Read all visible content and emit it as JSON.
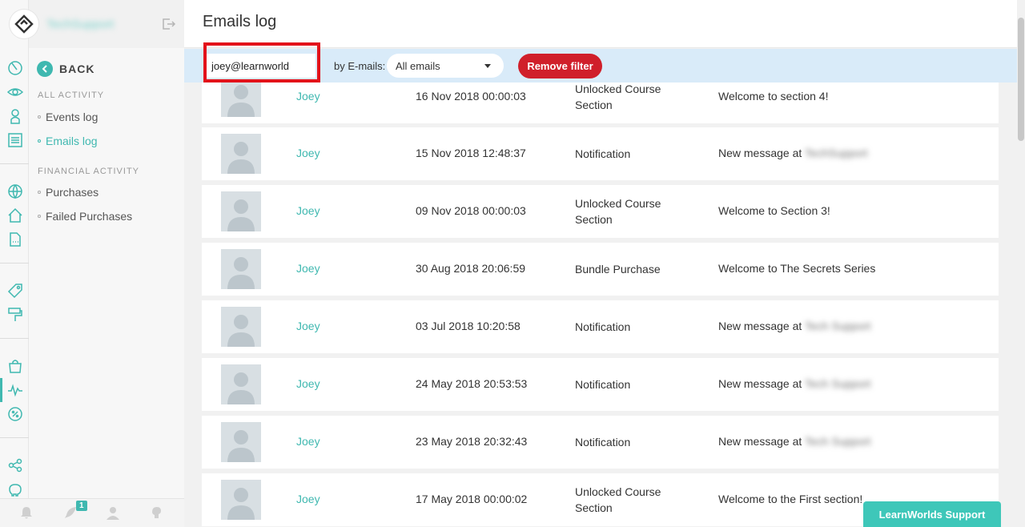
{
  "brand": {
    "name": "TechSupport"
  },
  "page": {
    "title": "Emails log"
  },
  "subnav": {
    "back_label": "BACK",
    "all_activity_heading": "ALL ACTIVITY",
    "financial_activity_heading": "FINANCIAL ACTIVITY",
    "items": [
      {
        "label": "Events log",
        "active": false
      },
      {
        "label": "Emails log",
        "active": true
      },
      {
        "label": "Purchases",
        "active": false
      },
      {
        "label": "Failed Purchases",
        "active": false
      }
    ]
  },
  "filter": {
    "search_value": "joey@learnworld",
    "by_label": "by E-mails:",
    "select_value": "All emails",
    "remove_label": "Remove filter"
  },
  "notification_count": "1",
  "rows": [
    {
      "name": "Joey",
      "date": "16 Nov 2018 00:00:03",
      "type": "Unlocked Course Section",
      "subject": "Welcome to section 4!",
      "subject_blur": ""
    },
    {
      "name": "Joey",
      "date": "15 Nov 2018 12:48:37",
      "type": "Notification",
      "subject": "New message at ",
      "subject_blur": "TechSupport"
    },
    {
      "name": "Joey",
      "date": "09 Nov 2018 00:00:03",
      "type": "Unlocked Course Section",
      "subject": "Welcome to Section 3!",
      "subject_blur": ""
    },
    {
      "name": "Joey",
      "date": "30 Aug 2018 20:06:59",
      "type": "Bundle Purchase",
      "subject": "Welcome to The Secrets Series",
      "subject_blur": ""
    },
    {
      "name": "Joey",
      "date": "03 Jul 2018 10:20:58",
      "type": "Notification",
      "subject": "New message at ",
      "subject_blur": "Tech Support"
    },
    {
      "name": "Joey",
      "date": "24 May 2018 20:53:53",
      "type": "Notification",
      "subject": "New message at ",
      "subject_blur": "Tech Support"
    },
    {
      "name": "Joey",
      "date": "23 May 2018 20:32:43",
      "type": "Notification",
      "subject": "New message at ",
      "subject_blur": "Tech Support"
    },
    {
      "name": "Joey",
      "date": "17 May 2018 00:00:02",
      "type": "Unlocked Course Section",
      "subject": "Welcome to the First section!",
      "subject_blur": ""
    }
  ],
  "support": {
    "label": "LearnWorlds Support"
  }
}
